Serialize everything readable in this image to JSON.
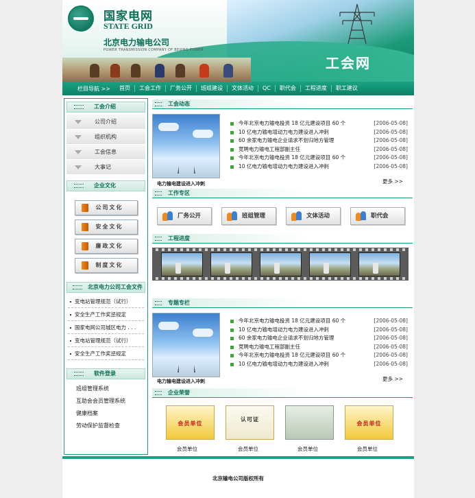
{
  "header": {
    "logo_cn": "国家电网",
    "logo_en": "STATE GRID",
    "company": "北京电力输电公司",
    "company_en": "POWER TRANSMISSION COMPANY OF BEIJING POWER",
    "site_title": "工会网",
    "logo_icon": "state-grid-logo-icon",
    "accent_color": "#0f8c6c"
  },
  "nav": {
    "lead": "栏目导航 >>",
    "items": [
      "首页",
      "工会工作",
      "厂务公开",
      "班组建设",
      "文体活动",
      "QC",
      "职代会",
      "工程进度",
      "职工建议"
    ]
  },
  "sidebar": {
    "union_title": "工会介绍",
    "union_items": [
      "公司介绍",
      "组织机构",
      "工会信息",
      "大事记"
    ],
    "culture_title": "企业文化",
    "culture_items": [
      "公司文化",
      "安全文化",
      "廉政文化",
      "制度文化"
    ],
    "docs_title": "北京电力公司工会文件",
    "docs": [
      "变电站管理规范（试行）",
      "安全生产工作奖惩规定",
      "国家电网公司城区电力 . . .",
      "变电站管理规范（试行）",
      "安全生产工作奖惩规定"
    ],
    "software_title": "软件登录",
    "software": [
      "班组管理系统",
      "互助会会员管理系统",
      "健康档案",
      "劳动保护监督检查"
    ]
  },
  "news": {
    "title": "工会动态",
    "photo_caption": "电力输电建设进入冲刺",
    "items": [
      {
        "text": "今年北京电力输电投资 18 亿元建设项目 60 个",
        "date": "[2006-05-08]"
      },
      {
        "text": "10 亿电力输电增动力电力建设进入冲刺",
        "date": "[2006-05-08]"
      },
      {
        "text": "60 余家电力输电企业请求不划归地方管理",
        "date": "[2006-05-08]"
      },
      {
        "text": "竞聘电力输电工程部副主任",
        "date": "[2006-05-08]"
      },
      {
        "text": "今年北京电力输电投资 18 亿元建设项目 60 个",
        "date": "[2006-05-08]"
      },
      {
        "text": "10 亿电力输电增动力电力建设进入冲刺",
        "date": "[2006-05-08]"
      }
    ],
    "more": "更多 >>"
  },
  "work": {
    "title": "工作专区",
    "buttons": [
      "厂务公开",
      "班组管理",
      "文体活动",
      "职代会"
    ]
  },
  "progress": {
    "title": "工程进度"
  },
  "special": {
    "title": "专题专栏",
    "photo_caption": "电力输电建设进入冲刺",
    "items": [
      {
        "text": "今年北京电力输电投资 18 亿元建设项目 60 个",
        "date": "[2006-05-08]"
      },
      {
        "text": "10 亿电力输电增动力电力建设进入冲刺",
        "date": "[2006-05-08]"
      },
      {
        "text": "60 余家电力输电企业请求不划归地方管理",
        "date": "[2006-05-08]"
      },
      {
        "text": "竞聘电力输电工程部副主任",
        "date": "[2006-05-08]"
      },
      {
        "text": "今年北京电力输电投资 18 亿元建设项目 60 个",
        "date": "[2006-05-08]"
      },
      {
        "text": "10 亿电力输电增动力电力建设进入冲刺",
        "date": "[2006-05-08]"
      }
    ],
    "more": "更多 >>"
  },
  "honor": {
    "title": "企业荣誉",
    "certs": [
      {
        "label": "会员单位",
        "stamp": "会员单位"
      },
      {
        "label": "会员单位",
        "stamp": "认可证"
      },
      {
        "label": "会员单位",
        "stamp": ""
      },
      {
        "label": "会员单位",
        "stamp": "会员单位"
      }
    ]
  },
  "footer": {
    "copyright": "北京输电公司版权所有"
  }
}
